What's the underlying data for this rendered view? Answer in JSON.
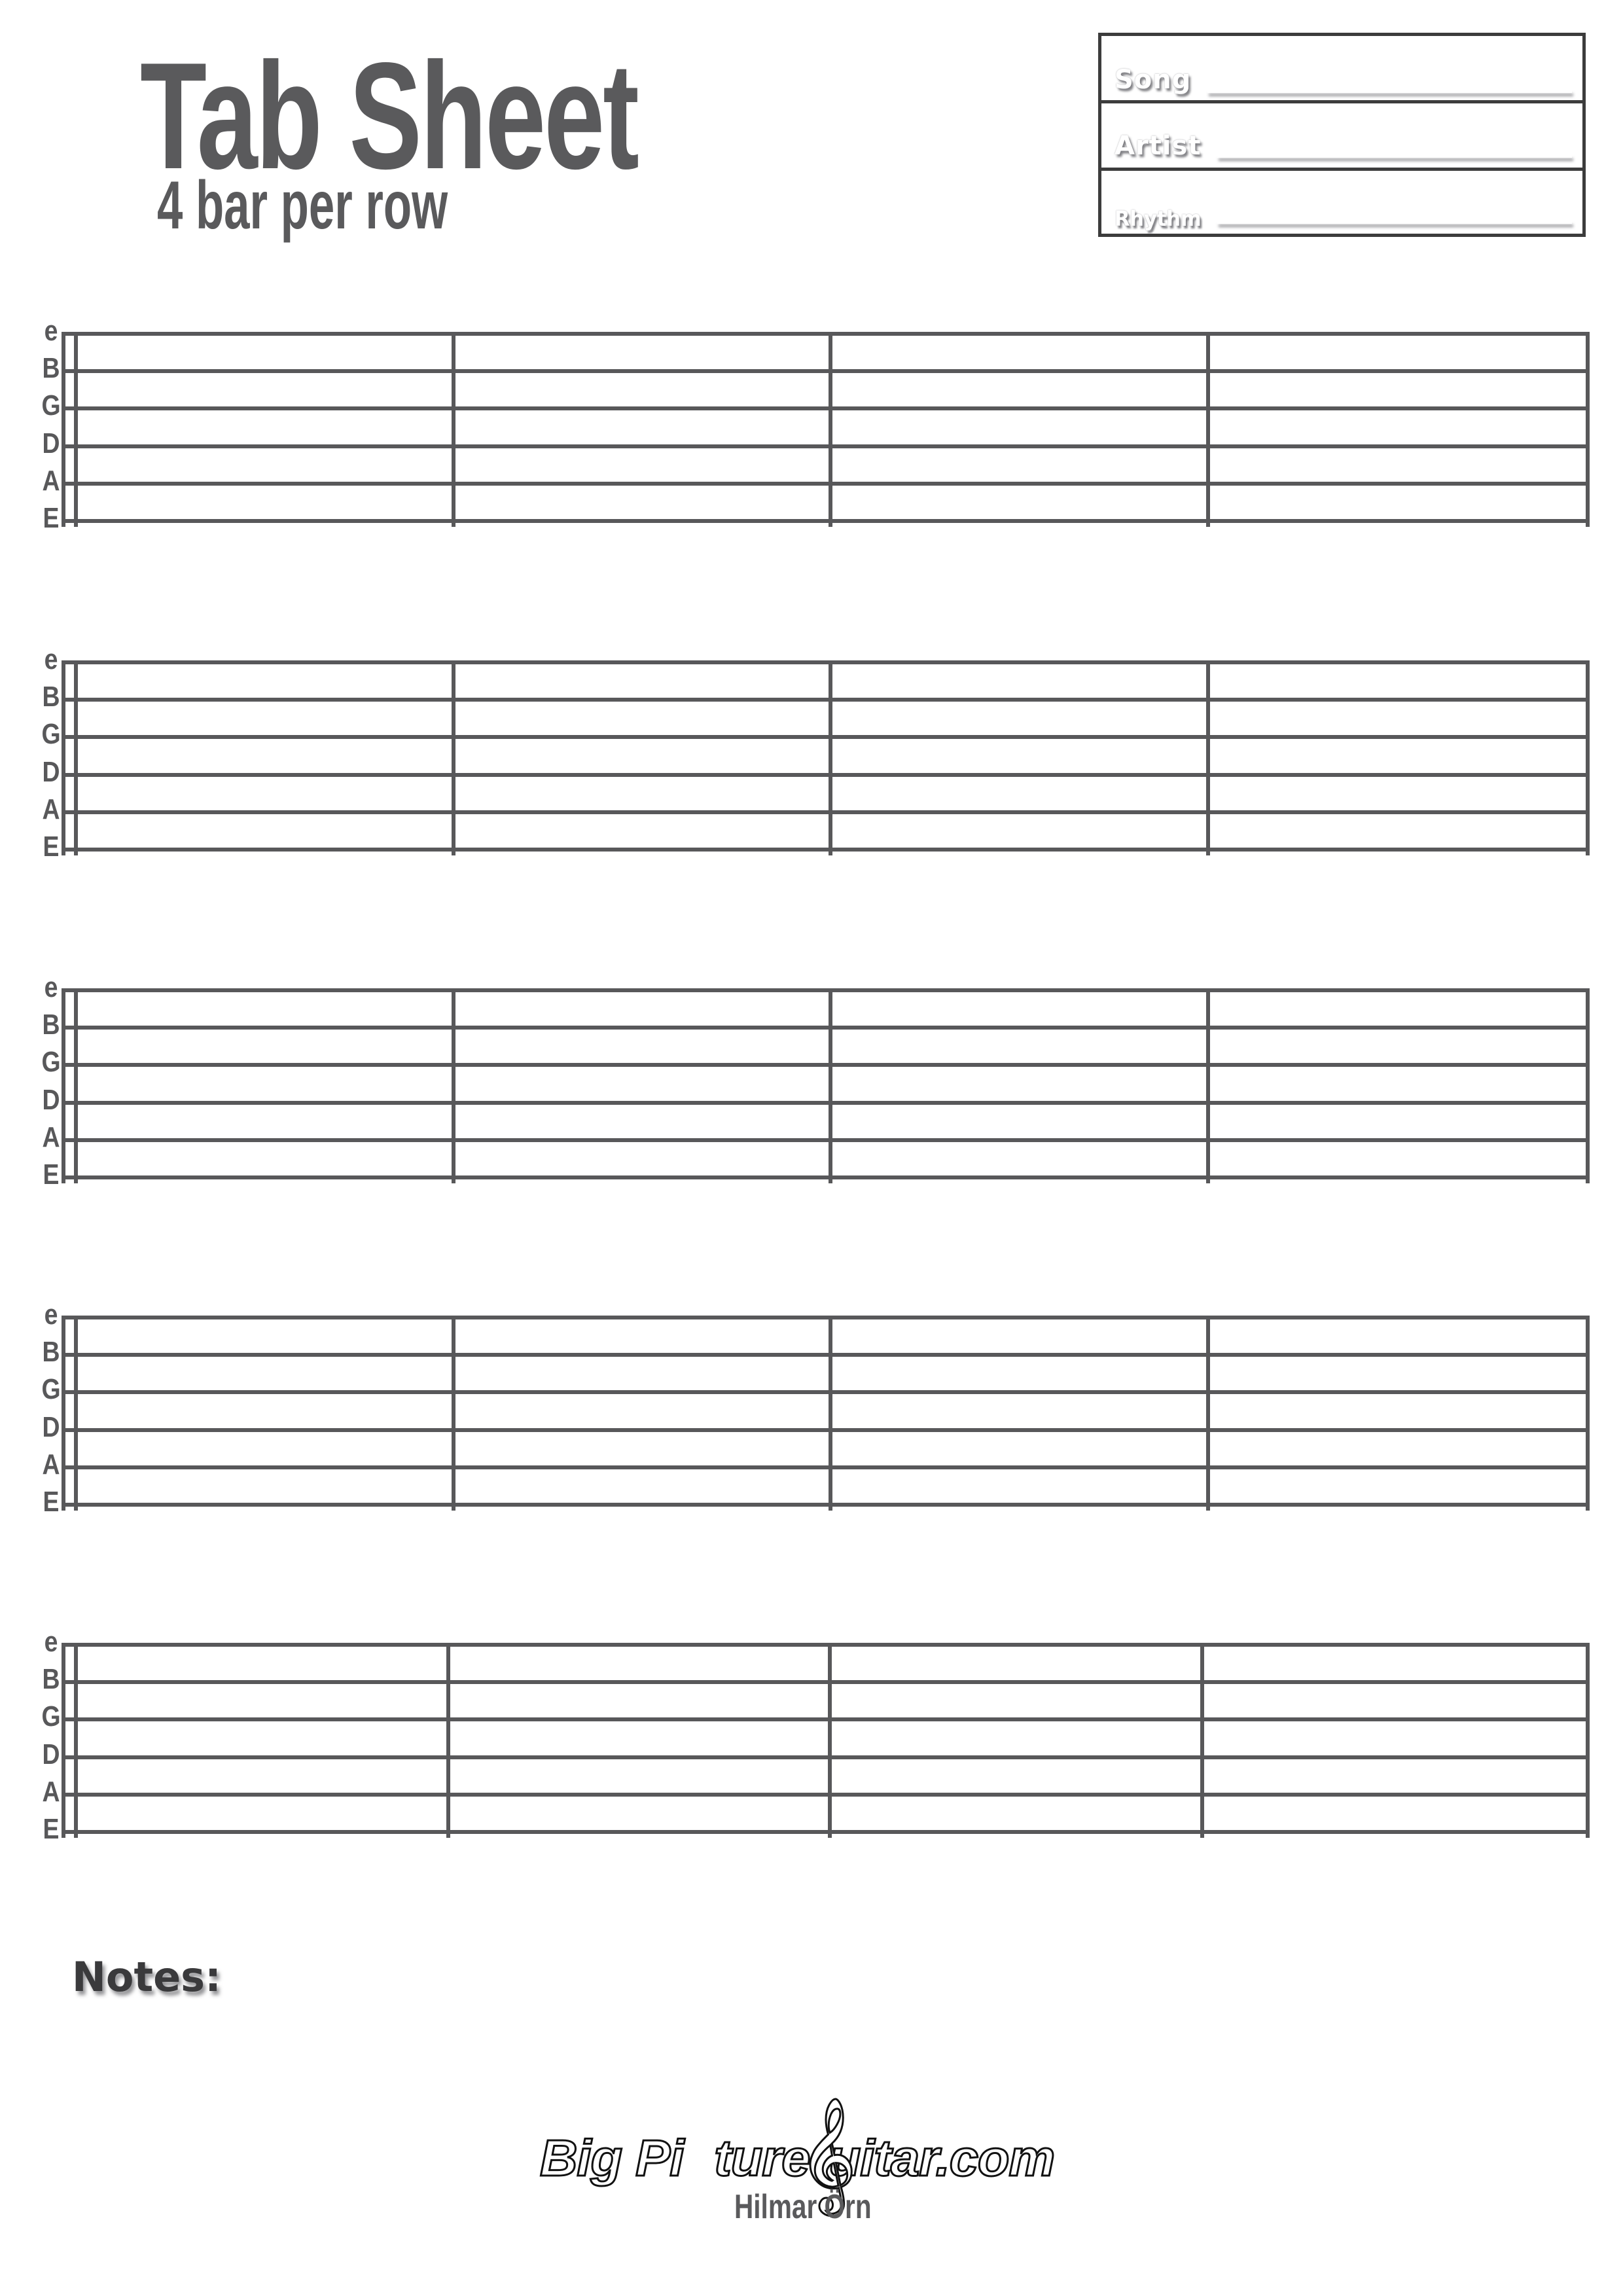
{
  "header": {
    "title": "Tab Sheet",
    "subtitle": "4 bar per row"
  },
  "info_box": {
    "fields": [
      {
        "label": "Song",
        "value": ""
      },
      {
        "label": "Artist",
        "value": ""
      },
      {
        "label": "Rhythm",
        "value": ""
      }
    ]
  },
  "staves": {
    "count": 5,
    "bars_per_row": 4,
    "string_labels": [
      "e",
      "B",
      "G",
      "D",
      "A",
      "E"
    ]
  },
  "notes": {
    "label": "Notes:"
  },
  "footer": {
    "logo_text": "Big Picture Guitar.com",
    "logo_parts": [
      "Big Pi",
      "ture ",
      "uitar.com"
    ],
    "clef_glyph": "𝄞",
    "author": "Hilmar Örn"
  },
  "colors": {
    "ink": "#58585a",
    "title": "#5a5a5c",
    "box_border": "#3c3c3c",
    "notes": "#3a3a3c"
  }
}
